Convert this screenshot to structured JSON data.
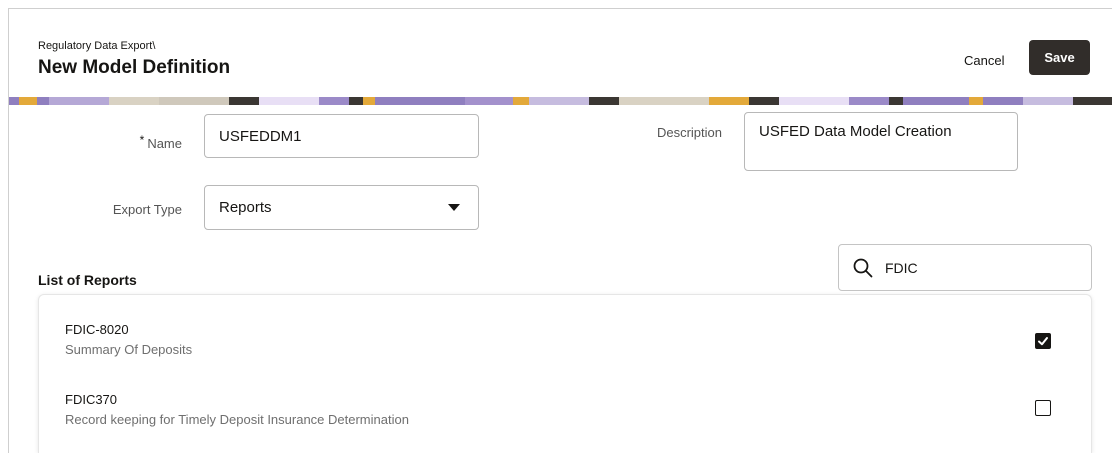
{
  "header": {
    "breadcrumb": "Regulatory Data Export\\",
    "title": "New Model Definition",
    "cancel_label": "Cancel",
    "save_label": "Save"
  },
  "form": {
    "name": {
      "label": "Name",
      "required_marker": "*",
      "value": "USFEDDM1"
    },
    "description": {
      "label": "Description",
      "value": "USFED Data Model Creation"
    },
    "export_type": {
      "label": "Export Type",
      "selected": "Reports"
    }
  },
  "reports": {
    "section_title": "List of Reports",
    "search": {
      "value": "FDIC",
      "icon": "search-icon"
    },
    "items": [
      {
        "code": "FDIC-8020",
        "description": "Summary Of Deposits",
        "checked": true
      },
      {
        "code": "FDIC370",
        "description": "Record keeping for Timely Deposit Insurance Determination",
        "checked": false
      }
    ]
  },
  "colors": {
    "primary_button": "#312d2a",
    "banner_purple": "#9b8ac8",
    "banner_gold": "#e3a93a"
  }
}
